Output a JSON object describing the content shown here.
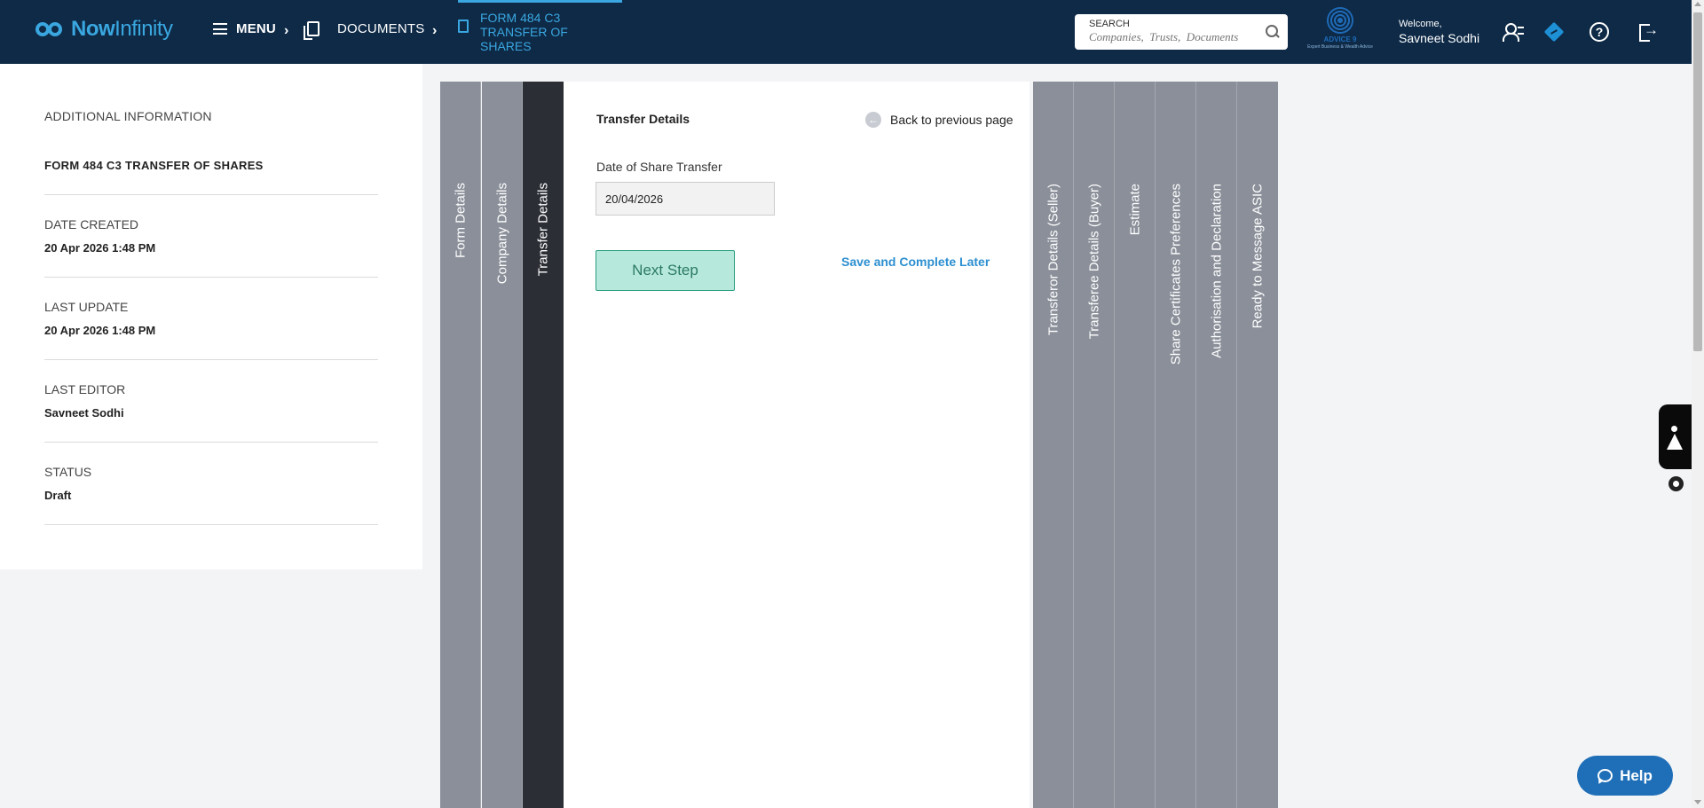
{
  "header": {
    "logo_text_bold": "Now",
    "logo_text_light": "Infinity",
    "menu_label": "MENU",
    "breadcrumb_documents": "DOCUMENTS",
    "breadcrumb_current": "FORM 484 C3 TRANSFER OF SHARES",
    "search_label": "SEARCH",
    "search_placeholder": "Companies,  Trusts,  Documents",
    "partner_logo_name": "ADVICE 9",
    "partner_logo_tagline": "Expert Business & Wealth Advice",
    "welcome_label": "Welcome,",
    "user_name": "Savneet Sodhi",
    "help_glyph": "?"
  },
  "info_panel": {
    "heading": "ADDITIONAL INFORMATION",
    "form_title": "FORM 484 C3 TRANSFER OF SHARES",
    "date_created_label": "DATE CREATED",
    "date_created_value": "20 Apr 2026 1:48 PM",
    "last_update_label": "LAST UPDATE",
    "last_update_value": "20 Apr 2026 1:48 PM",
    "last_editor_label": "LAST EDITOR",
    "last_editor_value": "Savneet Sodhi",
    "status_label": "STATUS",
    "status_value": "Draft"
  },
  "wizard": {
    "steps_before": [
      "Form Details",
      "Company Details",
      "Transfer Details"
    ],
    "active_step_index": 2,
    "steps_after": [
      "Transferor Details (Seller)",
      "Transferee Details (Buyer)",
      "Estimate",
      "Share Certificates Preferences",
      "Authorisation and Declaration",
      "Ready to Message ASIC"
    ],
    "section_title": "Transfer Details",
    "back_label": "Back to previous page",
    "date_field_label": "Date of Share Transfer",
    "date_field_value": "20/04/2026",
    "next_button_label": "Next Step",
    "save_later_label": "Save and Complete Later"
  },
  "widgets": {
    "help_button_label": "Help"
  },
  "colors": {
    "topbar": "#0e2a47",
    "accent": "#3aa7e0",
    "tab_inactive": "#8a8f99",
    "tab_active": "#2b2e35",
    "next_button_bg": "#b7e8dc",
    "next_button_border": "#2a9d80",
    "link": "#2c8fd0",
    "help_button": "#1f6fb8"
  }
}
